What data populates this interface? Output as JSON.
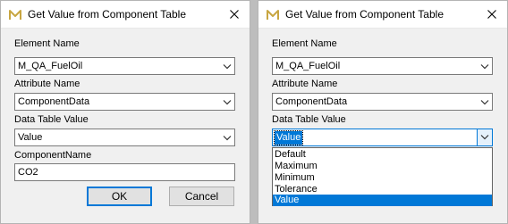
{
  "left": {
    "title": "Get Value from Component Table",
    "element_label": "Element Name",
    "element_value": "M_QA_FuelOil",
    "attribute_label": "Attribute Name",
    "attribute_value": "ComponentData",
    "table_value_label": "Data Table Value",
    "table_value_value": "Value",
    "component_name_label": "ComponentName",
    "component_name_value": "CO2",
    "ok_label": "OK",
    "cancel_label": "Cancel"
  },
  "right": {
    "title": "Get Value from Component Table",
    "element_label": "Element Name",
    "element_value": "M_QA_FuelOil",
    "attribute_label": "Attribute Name",
    "attribute_value": "ComponentData",
    "table_value_label": "Data Table Value",
    "table_value_value": "Value",
    "options": [
      "Default",
      "Maximum",
      "Minimum",
      "Tolerance",
      "Value"
    ],
    "selected_option": "Value"
  },
  "icons": {
    "app": "app-logo-icon",
    "close": "close-icon",
    "dropdown": "chevron-down-icon"
  },
  "colors": {
    "accent": "#0078d7",
    "dialog_bg": "#f0f0f0",
    "border": "#7a7a7a"
  }
}
